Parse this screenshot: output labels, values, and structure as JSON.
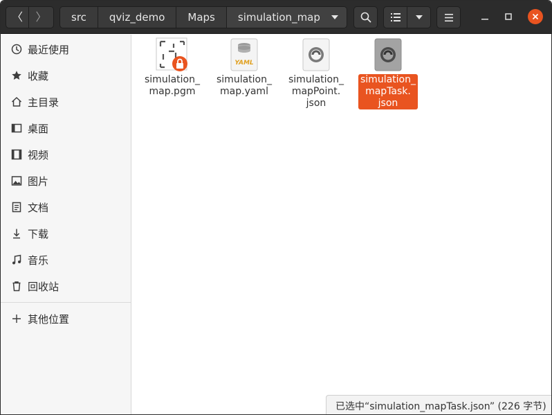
{
  "path": [
    {
      "label": "src"
    },
    {
      "label": "qviz_demo"
    },
    {
      "label": "Maps"
    },
    {
      "label": "simulation_map"
    }
  ],
  "sidebar": {
    "items": [
      {
        "label": "最近使用",
        "icon": "clock-icon"
      },
      {
        "label": "收藏",
        "icon": "star-icon"
      },
      {
        "label": "主目录",
        "icon": "home-icon"
      },
      {
        "label": "桌面",
        "icon": "desktop-icon"
      },
      {
        "label": "视频",
        "icon": "video-icon"
      },
      {
        "label": "图片",
        "icon": "picture-icon"
      },
      {
        "label": "文档",
        "icon": "document-icon"
      },
      {
        "label": "下载",
        "icon": "download-icon"
      },
      {
        "label": "音乐",
        "icon": "music-icon"
      },
      {
        "label": "回收站",
        "icon": "trash-icon"
      }
    ],
    "other_locations": {
      "label": "其他位置",
      "icon": "plus-icon"
    }
  },
  "files": [
    {
      "name": "simulation_map.pgm",
      "line1": "simulation_",
      "line2": "map.pgm",
      "line3": "",
      "icon": "image-file-icon",
      "locked": true,
      "selected": false
    },
    {
      "name": "simulation_map.yaml",
      "line1": "simulation_",
      "line2": "map.yaml",
      "line3": "",
      "icon": "yaml-file-icon",
      "badge": "YAML",
      "locked": false,
      "selected": false
    },
    {
      "name": "simulation_mapPoint.json",
      "line1": "simulation_",
      "line2": "mapPoint.",
      "line3": "json",
      "icon": "json-file-icon",
      "locked": false,
      "selected": false
    },
    {
      "name": "simulation_mapTask.json",
      "line1": "simulation_",
      "line2": "mapTask.",
      "line3": "json",
      "icon": "json-file-icon",
      "locked": false,
      "selected": true
    }
  ],
  "status": "已选中“simulation_mapTask.json” (226 字节)",
  "colors": {
    "accent": "#e95420",
    "headerbar": "#2c2c2c",
    "sidebar": "#f6f6f6"
  }
}
